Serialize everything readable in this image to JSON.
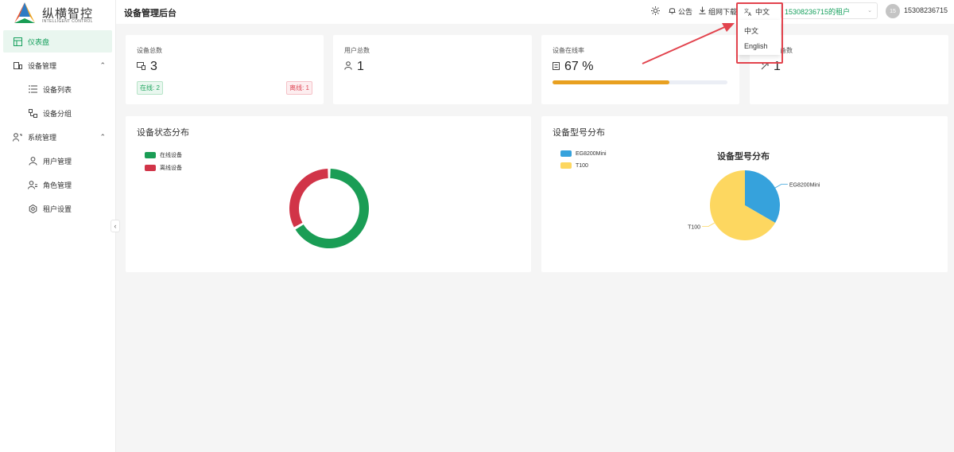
{
  "app": {
    "logo_cn": "纵横智控",
    "logo_en": "INTELLIGENT CONTROL"
  },
  "sidebar": {
    "items": [
      {
        "label": "仪表盘",
        "icon": "dashboard-icon"
      },
      {
        "label": "设备管理",
        "icon": "device-mgmt-icon"
      },
      {
        "label": "设备列表",
        "icon": "list-icon"
      },
      {
        "label": "设备分组",
        "icon": "group-icon"
      },
      {
        "label": "系统管理",
        "icon": "system-mgmt-icon"
      },
      {
        "label": "用户管理",
        "icon": "user-icon"
      },
      {
        "label": "角色管理",
        "icon": "role-icon"
      },
      {
        "label": "租户设置",
        "icon": "settings-icon"
      }
    ],
    "collapse": "‹"
  },
  "header": {
    "title": "设备管理后台",
    "announcement": "公告",
    "download": "组网下载",
    "language": "中文",
    "tenant": "15308236715的租户",
    "avatar": "15",
    "user": "15308236715"
  },
  "language_menu": {
    "options": [
      "中文",
      "English"
    ]
  },
  "stats": {
    "total_devices": {
      "label": "设备总数",
      "value": "3",
      "online": "在线: 2",
      "offline": "离线: 1"
    },
    "total_users": {
      "label": "用户总数",
      "value": "1"
    },
    "online_rate": {
      "label": "设备在线率",
      "value": "67 %",
      "progress": 0.67
    },
    "remote_devices": {
      "label": "远程设备数",
      "value": "1"
    }
  },
  "charts": {
    "status": {
      "title": "设备状态分布"
    },
    "model": {
      "title": "设备型号分布",
      "inner_title": "设备型号分布"
    }
  },
  "colors": {
    "accent": "#16a05d",
    "online": "#1a9d55",
    "offline": "#d13448",
    "eg": "#36a2dc",
    "t100": "#fdd760",
    "progress": "#e8a020"
  },
  "chart_data": [
    {
      "type": "pie",
      "subtype": "donut",
      "categories": [
        "在线设备",
        "离线设备"
      ],
      "values": [
        2,
        1
      ],
      "legend": "top-left"
    },
    {
      "type": "pie",
      "title": "设备型号分布",
      "categories": [
        "EG8200Mini",
        "T100"
      ],
      "values": [
        1,
        2
      ],
      "legend": "top-left"
    }
  ]
}
